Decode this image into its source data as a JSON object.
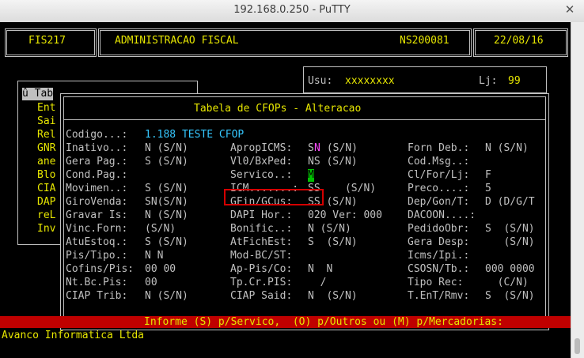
{
  "window": {
    "title": "192.168.0.250 - PuTTY",
    "close_glyph": "✕"
  },
  "header": {
    "code": "FIS217",
    "module": "ADMINISTRACAO FISCAL",
    "session": "NS200081",
    "date": "22/08/16"
  },
  "user_box": {
    "usu_label": "Usu:",
    "usu_value": "xxxxxxxx",
    "lj_label": "Lj:",
    "lj_value": "99"
  },
  "menu": {
    "items": [
      "û Tab",
      "Ent",
      "Sai",
      "Rel",
      "GNR",
      "ane",
      "Blo",
      "CIA",
      "DAP",
      "reL",
      "Inv"
    ]
  },
  "dialog": {
    "title": "Tabela de CFOPs - Alteracao",
    "codigo_label": "Codigo...:",
    "codigo_value": "1.188 TESTE CFOP",
    "col1": [
      {
        "label": "Inativo..:",
        "value": "N (S/N)"
      },
      {
        "label": "Gera Pag.:",
        "value": "S (S/N)"
      },
      {
        "label": "Cond.Pag.:",
        "value": ""
      },
      {
        "label": "Movimen..:",
        "value": "S (S/N)"
      },
      {
        "label": "GiroVenda:",
        "value": "SN(S/N)"
      },
      {
        "label": "Gravar Is:",
        "value": "N (S/N)"
      },
      {
        "label": "Vinc.Forn:",
        "value": "(S/N)"
      },
      {
        "label": "AtuEstoq.:",
        "value": "S (S/N)"
      },
      {
        "label": "Pis/Tipo.:",
        "value": "N N"
      },
      {
        "label": "Cofins/Pis:",
        "value": "00 00"
      },
      {
        "label": "Nt.Bc.Pis:",
        "value": "00"
      },
      {
        "label": "CIAP Trib:",
        "value": "N (S/N)"
      }
    ],
    "col2": [
      {
        "label": "ApropICMS:",
        "value": "S"
      },
      {
        "label": "Vl0/BxPed:",
        "value": "NS (S/N)"
      },
      {
        "label": "Servico..:",
        "value": "M"
      },
      {
        "label": "ICM.......:",
        "value": "SS    (S/N)"
      },
      {
        "label": "GFin/GCus:",
        "value": "SS (S/N)"
      },
      {
        "label": "DAPI Hor.:",
        "value": "020 Ver: 000"
      },
      {
        "label": "Bonific..:",
        "value": "N (S/N)"
      },
      {
        "label": "AtFichEst:",
        "value": "S  (S/N)"
      },
      {
        "label": "Mod-BC/ST:",
        "value": ""
      },
      {
        "label": "Ap-Pis/Co:",
        "value": "N  N"
      },
      {
        "label": "Tp.Cr.PIS:",
        "value": "  /"
      },
      {
        "label": "CIAP Said:",
        "value": "N  (S/N)"
      }
    ],
    "apropicms_extra_n": "N",
    "apropicms_extra_tail": " (S/N)",
    "col3": [
      {
        "label": "Forn Deb.:",
        "value": "N (S/N)"
      },
      {
        "label": "Cod.Msg..:",
        "value": ""
      },
      {
        "label": "Cl/For/Lj:",
        "value": "F"
      },
      {
        "label": "Preco....:",
        "value": "5"
      },
      {
        "label": "Dep/Gon/T:",
        "value": "D (D/G/T"
      },
      {
        "label": "DACOON....:",
        "value": ""
      },
      {
        "label": "PedidoObr:",
        "value": "S  (S/N)"
      },
      {
        "label": "Gera Desp:",
        "value": "   (S/N)"
      },
      {
        "label": "Icms/Ipi.:",
        "value": ""
      },
      {
        "label": "CSOSN/Tb.:",
        "value": "000 0000"
      },
      {
        "label": "Tipo Rec:",
        "value": "  (C/N)"
      },
      {
        "label": "T.EnT/Rmv:",
        "value": "S  (S/N)"
      }
    ]
  },
  "status_bar": {
    "message": "Informe (S) p/Servico,  (O) p/Outros ou (M) p/Mercadorias:"
  },
  "footer": {
    "company": "Avanco Informatica Ltda"
  },
  "colors": {
    "highlight_box": "#d40000",
    "status_bar": "#c00000",
    "cursor": "#00c000"
  }
}
